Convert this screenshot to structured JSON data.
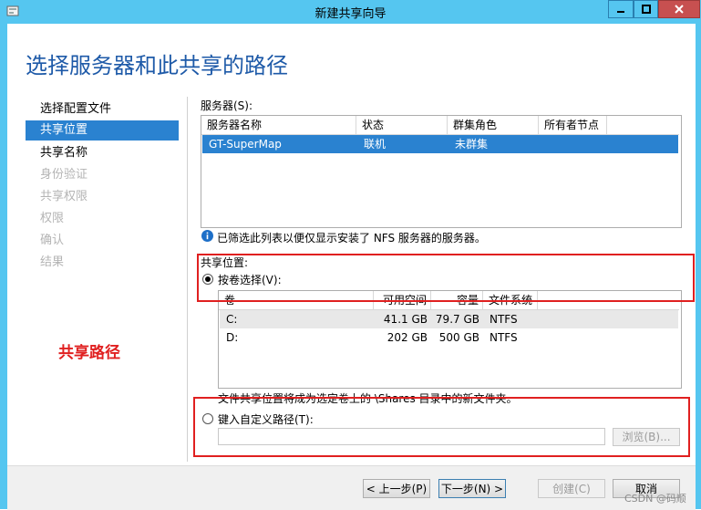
{
  "window": {
    "title": "新建共享向导"
  },
  "page_title": "选择服务器和此共享的路径",
  "nav": {
    "items": [
      {
        "label": "选择配置文件",
        "state": "normal"
      },
      {
        "label": "共享位置",
        "state": "selected"
      },
      {
        "label": "共享名称",
        "state": "normal"
      },
      {
        "label": "身份验证",
        "state": "disabled"
      },
      {
        "label": "共享权限",
        "state": "disabled"
      },
      {
        "label": "权限",
        "state": "disabled"
      },
      {
        "label": "确认",
        "state": "disabled"
      },
      {
        "label": "结果",
        "state": "disabled"
      }
    ]
  },
  "servers": {
    "label": "服务器(S):",
    "columns": [
      "服务器名称",
      "状态",
      "群集角色",
      "所有者节点"
    ],
    "rows": [
      {
        "name": "GT-SuperMap",
        "status": "联机",
        "cluster_role": "未群集",
        "owner": ""
      }
    ],
    "info": "已筛选此列表以便仅显示安装了 NFS 服务器的服务器。"
  },
  "share_location": {
    "label": "共享位置:",
    "by_volume_label": "按卷选择(V):",
    "volume_columns": [
      "卷",
      "可用空间",
      "容量",
      "文件系统"
    ],
    "volumes": [
      {
        "volume": "C:",
        "free": "41.1 GB",
        "capacity": "79.7 GB",
        "fs": "NTFS"
      },
      {
        "volume": "D:",
        "free": "202 GB",
        "capacity": "500 GB",
        "fs": "NTFS"
      }
    ],
    "note": "文件共享位置将成为选定卷上的 \\Shares 目录中的新文件夹。",
    "custom_path_label": "键入自定义路径(T):",
    "custom_path_value": "",
    "browse_label": "浏览(B)..."
  },
  "annotation": "共享路径",
  "footer": {
    "prev": "< 上一步(P)",
    "next": "下一步(N) >",
    "create": "创建(C)",
    "cancel": "取消"
  },
  "watermark": "CSDN @码顺"
}
